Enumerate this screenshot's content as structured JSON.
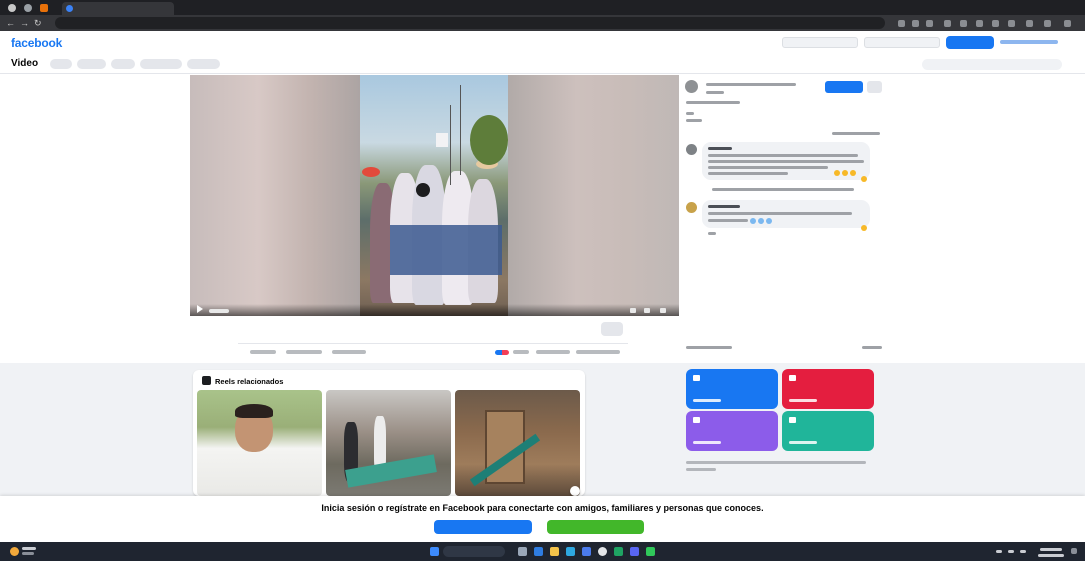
{
  "browser": {
    "tab_title": "",
    "url": ""
  },
  "header": {
    "logo": "facebook",
    "email_placeholder": "",
    "password_placeholder": "",
    "login_label": "",
    "forgot_label": ""
  },
  "video_nav": {
    "title": "Video",
    "pills": [
      "",
      "",
      "",
      "",
      ""
    ],
    "search_placeholder": ""
  },
  "post": {
    "caption_line1": "",
    "caption_line2": "",
    "author": "",
    "follow_label": "",
    "reactions": ""
  },
  "comments": [
    {
      "avatar_color": "#7e8286"
    },
    {
      "avatar_color": "#c8a24a"
    }
  ],
  "reels": {
    "title": "Reels relacionados",
    "thumbnails": 3
  },
  "categories": [
    {
      "name": "",
      "color": "#1877f2"
    },
    {
      "name": "",
      "color": "#e41e3f"
    },
    {
      "name": "",
      "color": "#8c5cea"
    },
    {
      "name": "",
      "color": "#20b59a"
    }
  ],
  "banner": {
    "text": "Inicia sesión o regístrate en Facebook para conectarte con amigos, familiares y personas que conoces.",
    "login_label": "",
    "or_label": "",
    "signup_label": "",
    "login_color": "#1877f2",
    "signup_color": "#42b72a"
  },
  "taskbar": {
    "search_placeholder": ""
  }
}
